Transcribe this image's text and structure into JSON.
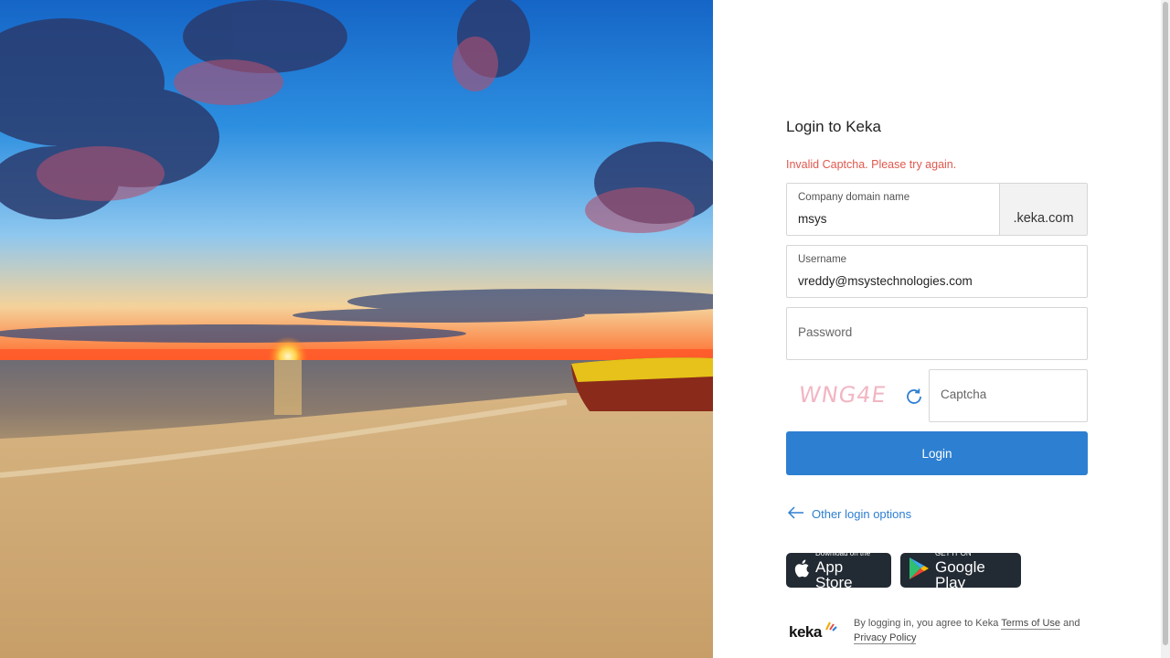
{
  "form": {
    "title": "Login to Keka",
    "error": "Invalid Captcha. Please try again.",
    "domain_label": "Company domain name",
    "domain_value": "msys",
    "domain_suffix": ".keka.com",
    "username_label": "Username",
    "username_value": "vreddy@msystechnologies.com",
    "password_placeholder": "Password",
    "captcha_text": "WNG4E",
    "captcha_placeholder": "Captcha",
    "login_label": "Login",
    "other_options": "Other login options"
  },
  "stores": {
    "apple_small": "Download on the",
    "apple_big": "App Store",
    "google_small": "GET IT ON",
    "google_big": "Google Play"
  },
  "footer": {
    "logo": "keka",
    "legal_prefix": "By logging in, you agree to Keka",
    "terms": "Terms of Use",
    "and": "and",
    "privacy": "Privacy Policy"
  },
  "colors": {
    "accent": "#2d7fd1",
    "error": "#e0584e",
    "store_bg": "#222a33"
  }
}
